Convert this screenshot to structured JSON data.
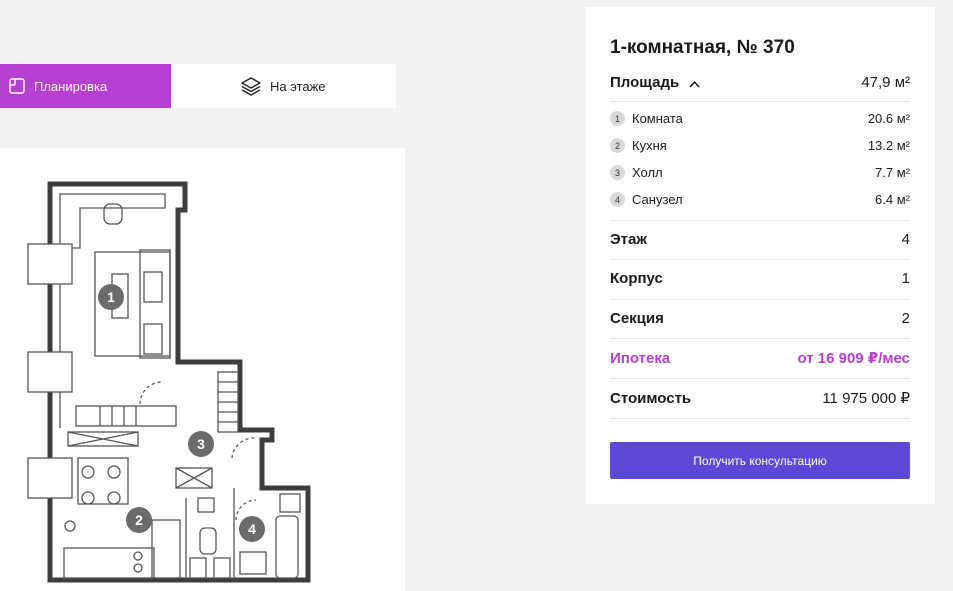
{
  "tabs": {
    "plan_label": "Планировка",
    "floor_label": "На этаже"
  },
  "plan": {
    "rooms": [
      "1",
      "2",
      "3",
      "4"
    ]
  },
  "card": {
    "title": "1-комнатная, № 370",
    "area_label": "Площадь",
    "area_value": "47,9 м²",
    "rooms": [
      {
        "num": "1",
        "name": "Комната",
        "area": "20.6 м²"
      },
      {
        "num": "2",
        "name": "Кухня",
        "area": "13.2 м²"
      },
      {
        "num": "3",
        "name": "Холл",
        "area": "7.7 м²"
      },
      {
        "num": "4",
        "name": "Санузел",
        "area": "6.4 м²"
      }
    ],
    "floor_label": "Этаж",
    "floor_value": "4",
    "building_label": "Корпус",
    "building_value": "1",
    "section_label": "Секция",
    "section_value": "2",
    "mortgage_label": "Ипотека",
    "mortgage_value": "от 16 909 ₽/мес",
    "price_label": "Стоимость",
    "price_value": "11 975 000 ₽",
    "cta_label": "Получить консультацию"
  },
  "colors": {
    "accent_purple": "#b43fd0",
    "button_blue": "#5a49d6"
  }
}
